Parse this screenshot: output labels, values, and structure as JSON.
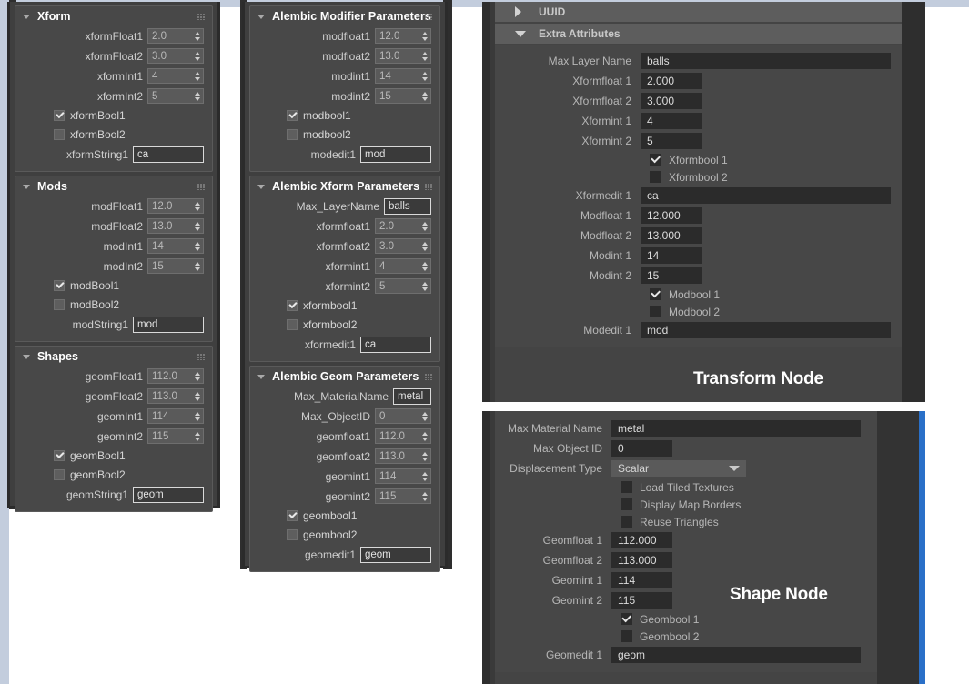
{
  "colors": {
    "top_strip": "#c3cddd",
    "max_panel_bg": "#3f3f3f",
    "max_rollout_bg": "#484848",
    "maya_panel_bg": "#444444",
    "maya_header_bg": "#5d5d5d",
    "maya_field_bg": "#2b2b2b",
    "scrollbar_blue": "#2a70c8",
    "gold_line": "#8c7524"
  },
  "max_command_panel": {
    "rollouts": [
      {
        "title": "Xform",
        "spinners": [
          {
            "label": "xformFloat1",
            "value": "2.0"
          },
          {
            "label": "xformFloat2",
            "value": "3.0"
          },
          {
            "label": "xformInt1",
            "value": "4"
          },
          {
            "label": "xformInt2",
            "value": "5"
          }
        ],
        "checkboxes": [
          {
            "label": "xformBool1",
            "checked": true
          },
          {
            "label": "xformBool2",
            "checked": false
          }
        ],
        "edit": {
          "label": "xformString1",
          "value": "ca"
        }
      },
      {
        "title": "Mods",
        "spinners": [
          {
            "label": "modFloat1",
            "value": "12.0"
          },
          {
            "label": "modFloat2",
            "value": "13.0"
          },
          {
            "label": "modInt1",
            "value": "14"
          },
          {
            "label": "modInt2",
            "value": "15"
          }
        ],
        "checkboxes": [
          {
            "label": "modBool1",
            "checked": true
          },
          {
            "label": "modBool2",
            "checked": false
          }
        ],
        "edit": {
          "label": "modString1",
          "value": "mod"
        }
      },
      {
        "title": "Shapes",
        "spinners": [
          {
            "label": "geomFloat1",
            "value": "112.0"
          },
          {
            "label": "geomFloat2",
            "value": "113.0"
          },
          {
            "label": "geomInt1",
            "value": "114"
          },
          {
            "label": "geomInt2",
            "value": "115"
          }
        ],
        "checkboxes": [
          {
            "label": "geomBool1",
            "checked": true
          },
          {
            "label": "geomBool2",
            "checked": false
          }
        ],
        "edit": {
          "label": "geomString1",
          "value": "geom"
        }
      }
    ]
  },
  "alembic_panel": {
    "rollouts": [
      {
        "title": "Alembic Modifier Parameters",
        "top_edit": null,
        "spinners": [
          {
            "label": "modfloat1",
            "value": "12.0"
          },
          {
            "label": "modfloat2",
            "value": "13.0"
          },
          {
            "label": "modint1",
            "value": "14"
          },
          {
            "label": "modint2",
            "value": "15"
          }
        ],
        "checkboxes": [
          {
            "label": "modbool1",
            "checked": true
          },
          {
            "label": "modbool2",
            "checked": false
          }
        ],
        "edit": {
          "label": "modedit1",
          "value": "mod"
        }
      },
      {
        "title": "Alembic Xform Parameters",
        "top_edit": {
          "label": "Max_LayerName",
          "value": "balls"
        },
        "spinners": [
          {
            "label": "xformfloat1",
            "value": "2.0"
          },
          {
            "label": "xformfloat2",
            "value": "3.0"
          },
          {
            "label": "xformint1",
            "value": "4"
          },
          {
            "label": "xformint2",
            "value": "5"
          }
        ],
        "checkboxes": [
          {
            "label": "xformbool1",
            "checked": true
          },
          {
            "label": "xformbool2",
            "checked": false
          }
        ],
        "edit": {
          "label": "xformedit1",
          "value": "ca"
        }
      },
      {
        "title": "Alembic Geom Parameters",
        "top_edit": {
          "label": "Max_MaterialName",
          "value": "metal"
        },
        "object_id": {
          "label": "Max_ObjectID",
          "value": "0"
        },
        "spinners": [
          {
            "label": "geomfloat1",
            "value": "112.0"
          },
          {
            "label": "geomfloat2",
            "value": "113.0"
          },
          {
            "label": "geomint1",
            "value": "114"
          },
          {
            "label": "geomint2",
            "value": "115"
          }
        ],
        "checkboxes": [
          {
            "label": "geombool1",
            "checked": true
          },
          {
            "label": "geombool2",
            "checked": false
          }
        ],
        "edit": {
          "label": "geomedit1",
          "value": "geom"
        }
      }
    ]
  },
  "transform_node": {
    "caption": "Transform Node",
    "sections": [
      {
        "title": "UUID",
        "expanded": false
      },
      {
        "title": "Extra Attributes",
        "expanded": true
      }
    ],
    "fields": [
      {
        "label": "Max Layer Name",
        "value": "balls",
        "wide": true
      },
      {
        "label": "Xformfloat 1",
        "value": "2.000",
        "wide": false
      },
      {
        "label": "Xformfloat 2",
        "value": "3.000",
        "wide": false
      },
      {
        "label": "Xformint 1",
        "value": "4",
        "wide": false
      },
      {
        "label": "Xformint 2",
        "value": "5",
        "wide": false
      }
    ],
    "checkboxes_1": [
      {
        "label": "Xformbool 1",
        "checked": true
      },
      {
        "label": "Xformbool 2",
        "checked": false
      }
    ],
    "fields_2": [
      {
        "label": "Xformedit 1",
        "value": "ca",
        "wide": true
      },
      {
        "label": "Modfloat 1",
        "value": "12.000",
        "wide": false
      },
      {
        "label": "Modfloat 2",
        "value": "13.000",
        "wide": false
      },
      {
        "label": "Modint 1",
        "value": "14",
        "wide": false
      },
      {
        "label": "Modint 2",
        "value": "15",
        "wide": false
      }
    ],
    "checkboxes_2": [
      {
        "label": "Modbool 1",
        "checked": true
      },
      {
        "label": "Modbool 2",
        "checked": false
      }
    ],
    "fields_3": [
      {
        "label": "Modedit 1",
        "value": "mod",
        "wide": true
      }
    ]
  },
  "shape_node": {
    "caption": "Shape Node",
    "fields_top": [
      {
        "label": "Max Material Name",
        "value": "metal",
        "wide": true
      },
      {
        "label": "Max Object ID",
        "value": "0",
        "wide": false
      }
    ],
    "dropdown": {
      "label": "Displacement Type",
      "value": "Scalar"
    },
    "checkboxes_top": [
      {
        "label": "Load Tiled Textures",
        "checked": false
      },
      {
        "label": "Display Map Borders",
        "checked": false
      },
      {
        "label": "Reuse Triangles",
        "checked": false
      }
    ],
    "fields_mid": [
      {
        "label": "Geomfloat 1",
        "value": "112.000",
        "wide": false
      },
      {
        "label": "Geomfloat 2",
        "value": "113.000",
        "wide": false
      },
      {
        "label": "Geomint 1",
        "value": "114",
        "wide": false
      },
      {
        "label": "Geomint 2",
        "value": "115",
        "wide": false
      }
    ],
    "checkboxes_mid": [
      {
        "label": "Geombool 1",
        "checked": true
      },
      {
        "label": "Geombool 2",
        "checked": false
      }
    ],
    "fields_bottom": [
      {
        "label": "Geomedit 1",
        "value": "geom",
        "wide": true
      }
    ]
  }
}
